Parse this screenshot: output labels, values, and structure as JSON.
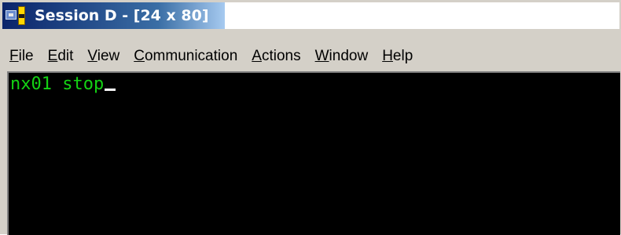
{
  "window": {
    "title": "Session D - [24 x 80]"
  },
  "menu": {
    "items": [
      {
        "pre": "",
        "accel": "F",
        "post": "ile"
      },
      {
        "pre": "",
        "accel": "E",
        "post": "dit"
      },
      {
        "pre": "",
        "accel": "V",
        "post": "iew"
      },
      {
        "pre": "",
        "accel": "C",
        "post": "ommunication"
      },
      {
        "pre": "",
        "accel": "A",
        "post": "ctions"
      },
      {
        "pre": "",
        "accel": "W",
        "post": "indow"
      },
      {
        "pre": "",
        "accel": "H",
        "post": "elp"
      }
    ]
  },
  "terminal": {
    "line1": "nx01 stop",
    "text_color": "#14d214",
    "background": "#000000"
  },
  "colors": {
    "titlebar_start": "#0a246a",
    "titlebar_end": "#a6caf0",
    "chrome": "#d4d0c8"
  },
  "icons": {
    "app_icon": "terminal-emulator-icon"
  }
}
